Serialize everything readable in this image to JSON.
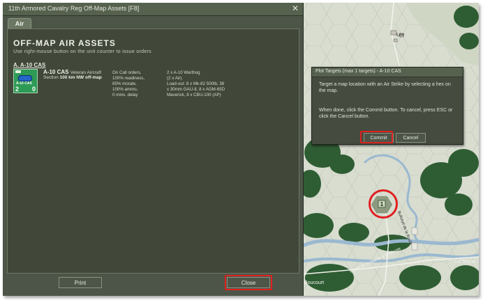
{
  "window": {
    "title": "11th Armored Cavalry Reg Off-Map Assets   [F8]",
    "close_glyph": "✕"
  },
  "tabs": [
    {
      "label": "Air",
      "active": true
    }
  ],
  "panel": {
    "heading": "OFF-MAP AIR ASSETS",
    "subheading": "Use right-mouse button on the unit counter to issue orders",
    "section_title": "A. A-10 CAS"
  },
  "unit": {
    "counter_label": "A-10 CAS",
    "counter_strength_left": "2",
    "counter_strength_right": "0",
    "counter_color": "#2d9a55",
    "name": "A-10 CAS",
    "quality": "Veteran Aircraft",
    "section_prefix": "Section",
    "section_detail": "100 km NW off-map",
    "status_lines": [
      "On Call orders,",
      "100% readiness,",
      "85% morale,",
      "100% ammo,",
      "0 mins. delay"
    ],
    "loadout_lines": [
      "2 x A-10 Warthog",
      "(2 x Air).",
      "Load-out: 8 x Mk-82 500lb, 38",
      "x 30mm GAU-8, 8 x AGM-65D",
      "Maverick, 8 x CBU-100 (AP)"
    ]
  },
  "buttons": {
    "print": "Print",
    "close": "Close"
  },
  "plot_targets": {
    "title": "Plot Targets (max 1 targets) - A-10 CAS",
    "message1": "Target a map location with an Air Strike by selecting a hex on the map.",
    "message2": "When done, click the Commit button. To cancel, press ESC or click the Cancel button.",
    "commit_label": "Commit",
    "cancel_label": "Cancel"
  },
  "map": {
    "hex_marker_label": "1",
    "place_labels": [
      "Lev",
      "Boucourt",
      "Le Tenno"
    ],
    "road_labels": [
      "Bullseye de la Roulle",
      "Canal de la Marne a la Meuse"
    ]
  },
  "colors": {
    "highlight": "#e02020",
    "panel_bg": "#414739",
    "map_bg": "#d8ddd0",
    "river": "#9ab8d0",
    "forest": "#2f5d33"
  },
  "icons": {
    "close": "close-icon",
    "aircraft": "aircraft-icon"
  }
}
